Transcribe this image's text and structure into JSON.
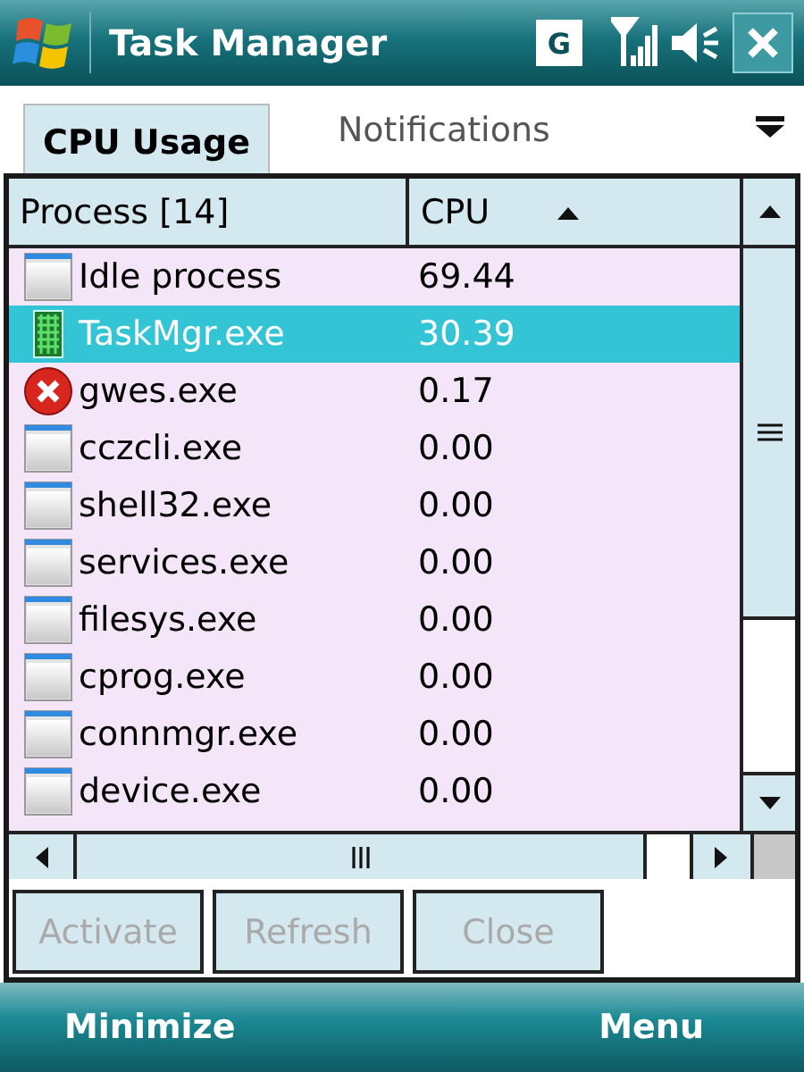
{
  "title_bar": {
    "title": "Task Manager",
    "status_letter": "G"
  },
  "tabs": [
    {
      "label": "CPU Usage",
      "selected": true
    },
    {
      "label": "Notifications",
      "selected": false
    }
  ],
  "table": {
    "columns": [
      "Process [14]",
      "CPU"
    ],
    "rows": [
      {
        "kind": "window",
        "name": "Idle process",
        "cpu": "69.44",
        "selected": false
      },
      {
        "kind": "grid",
        "name": "TaskMgr.exe",
        "cpu": "30.39",
        "selected": true
      },
      {
        "kind": "error",
        "name": "gwes.exe",
        "cpu": "0.17",
        "selected": false
      },
      {
        "kind": "window",
        "name": "cczcli.exe",
        "cpu": "0.00",
        "selected": false
      },
      {
        "kind": "window",
        "name": "shell32.exe",
        "cpu": "0.00",
        "selected": false
      },
      {
        "kind": "window",
        "name": "services.exe",
        "cpu": "0.00",
        "selected": false
      },
      {
        "kind": "window",
        "name": "filesys.exe",
        "cpu": "0.00",
        "selected": false
      },
      {
        "kind": "window",
        "name": "cprog.exe",
        "cpu": "0.00",
        "selected": false
      },
      {
        "kind": "window",
        "name": "connmgr.exe",
        "cpu": "0.00",
        "selected": false
      },
      {
        "kind": "window",
        "name": "device.exe",
        "cpu": "0.00",
        "selected": false
      }
    ]
  },
  "buttons": [
    {
      "label": "Activate",
      "disabled": true
    },
    {
      "label": "Refresh",
      "disabled": true
    },
    {
      "label": "Close",
      "disabled": true
    }
  ],
  "softkeys": [
    "Minimize",
    "Menu"
  ]
}
